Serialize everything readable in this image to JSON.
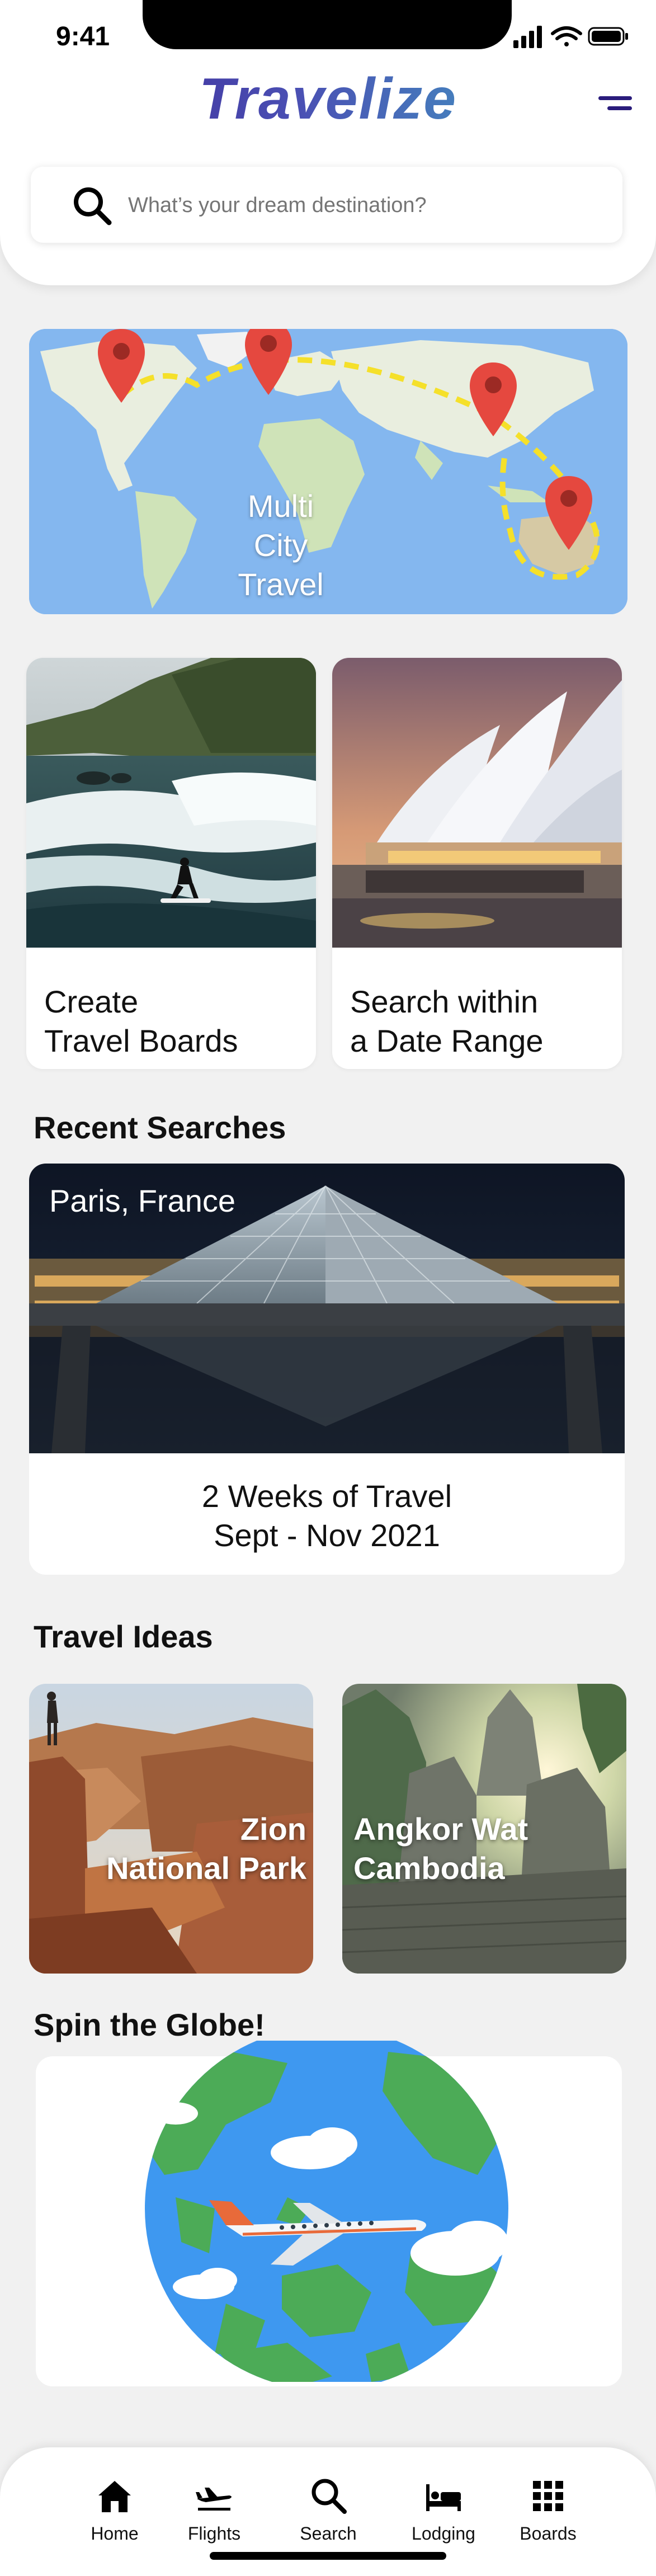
{
  "status": {
    "time": "9:41"
  },
  "app": {
    "name": "Travelize"
  },
  "search": {
    "placeholder": "What’s your dream destination?"
  },
  "map_card": {
    "label_lines": [
      "Multi",
      "City",
      "Travel"
    ]
  },
  "features": [
    {
      "label_lines": [
        "Create",
        "Travel Boards"
      ]
    },
    {
      "label_lines": [
        "Search within",
        "a Date Range"
      ]
    }
  ],
  "recent": {
    "title": "Recent Searches",
    "city": "Paris, France",
    "line1": "2 Weeks of Travel",
    "line2": "Sept - Nov 2021"
  },
  "ideas": {
    "title": "Travel Ideas",
    "items": [
      {
        "line1": "Zion",
        "line2": "National Park"
      },
      {
        "line1": "Angkor Wat",
        "line2": "Cambodia"
      }
    ]
  },
  "globe": {
    "title": "Spin the Globe!"
  },
  "tabs": [
    {
      "label": "Home",
      "icon": "home-icon"
    },
    {
      "label": "Flights",
      "icon": "plane-icon"
    },
    {
      "label": "Search",
      "icon": "search-icon"
    },
    {
      "label": "Lodging",
      "icon": "bed-icon"
    },
    {
      "label": "Boards",
      "icon": "grid-icon"
    }
  ],
  "colors": {
    "brand_gradient_start": "#3b1f8f",
    "brand_gradient_end": "#3fb5c8",
    "pin_red": "#e5483f",
    "route_yellow": "#f5e02a",
    "ocean_blue": "#3e98f0",
    "land_green": "#4cab57"
  }
}
